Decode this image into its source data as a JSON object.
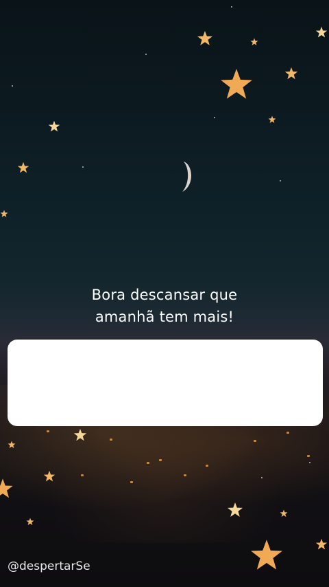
{
  "story": {
    "caption_line_1": "Bora descansar que",
    "caption_line_2": "amanhã tem mais!",
    "handle": "@despertarSe",
    "reply_placeholder": ""
  },
  "colors": {
    "star": "#f2b866",
    "star_dim": "#f5d79a",
    "text": "#ffffff",
    "reply_box": "#ffffff"
  },
  "icons": {
    "star": "star-icon",
    "moon": "crescent-moon-icon"
  }
}
